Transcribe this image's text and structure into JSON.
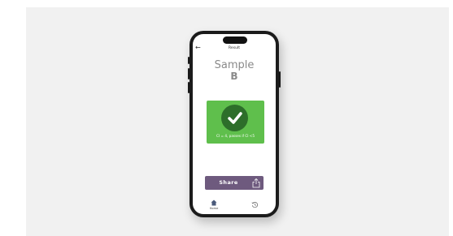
{
  "header": {
    "back_icon": "arrow-left-icon",
    "title": "Result"
  },
  "sample": {
    "word": "Sample",
    "letter": "B"
  },
  "result": {
    "status_icon": "checkmark-circle-icon",
    "text": "CI = 4, passes if CI <5",
    "card_color": "#5fbf4c",
    "badge_color": "#2d6e2a"
  },
  "share": {
    "label": "Share",
    "icon": "share-icon",
    "color": "#6e5a7e"
  },
  "tabbar": {
    "home": {
      "label": "Home",
      "icon": "home-icon"
    },
    "history": {
      "icon": "history-icon"
    }
  }
}
